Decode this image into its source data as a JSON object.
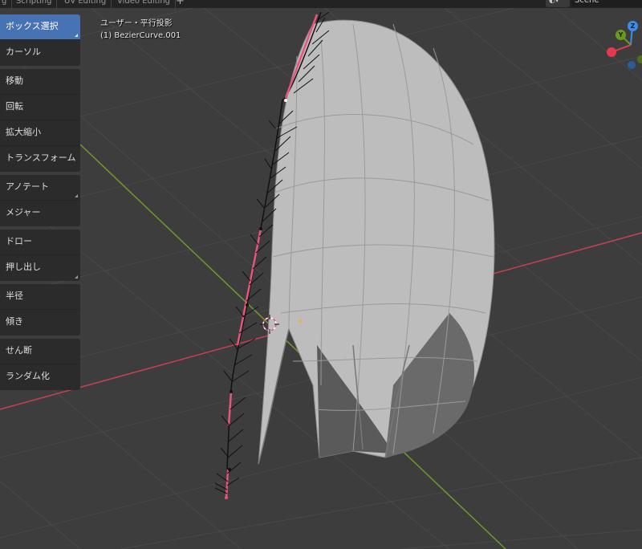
{
  "header": {
    "tabs": [
      {
        "id": "prev",
        "label": "g"
      },
      {
        "id": "scripting",
        "label": "Scripting"
      },
      {
        "id": "uv",
        "label": "UV Editing"
      },
      {
        "id": "video",
        "label": "Video Editing"
      }
    ],
    "add_tab": "+",
    "scene_label": "Scene"
  },
  "toolbar": {
    "groups": [
      {
        "items": [
          {
            "id": "select-box",
            "label": "ボックス選択",
            "active": true,
            "submenu": true
          },
          {
            "id": "cursor",
            "label": "カーソル",
            "active": false,
            "submenu": false
          }
        ]
      },
      {
        "items": [
          {
            "id": "move",
            "label": "移動",
            "active": false,
            "submenu": false
          },
          {
            "id": "rotate",
            "label": "回転",
            "active": false,
            "submenu": false
          },
          {
            "id": "scale",
            "label": "拡大縮小",
            "active": false,
            "submenu": false
          },
          {
            "id": "transform",
            "label": "トランスフォーム",
            "active": false,
            "submenu": false
          }
        ]
      },
      {
        "items": [
          {
            "id": "annotate",
            "label": "アノテート",
            "active": false,
            "submenu": true
          },
          {
            "id": "measure",
            "label": "メジャー",
            "active": false,
            "submenu": false
          }
        ]
      },
      {
        "items": [
          {
            "id": "draw",
            "label": "ドロー",
            "active": false,
            "submenu": false
          },
          {
            "id": "extrude",
            "label": "押し出し",
            "active": false,
            "submenu": true
          }
        ]
      },
      {
        "items": [
          {
            "id": "radius",
            "label": "半径",
            "active": false,
            "submenu": false
          },
          {
            "id": "tilt",
            "label": "傾き",
            "active": false,
            "submenu": false
          }
        ]
      },
      {
        "items": [
          {
            "id": "shear",
            "label": "せん断",
            "active": false,
            "submenu": false
          },
          {
            "id": "randomize",
            "label": "ランダム化",
            "active": false,
            "submenu": false
          }
        ]
      }
    ]
  },
  "viewport": {
    "view_name": "ユーザー・平行投影",
    "object_name": "(1) BezierCurve.001"
  },
  "gizmo": {
    "z_label": "Z",
    "y_label": "Y"
  },
  "colors": {
    "background": "#3d3d3d",
    "grid": "#484848",
    "x_axis": "#c8404f",
    "y_axis": "#6f9a2a",
    "active_tool": "#4772b3",
    "mesh": "#bdbdbd",
    "curve_selected": "#e8557a",
    "gizmo_x": "#e8384f",
    "gizmo_y": "#6b9a1f",
    "gizmo_z": "#3a8ee6"
  }
}
